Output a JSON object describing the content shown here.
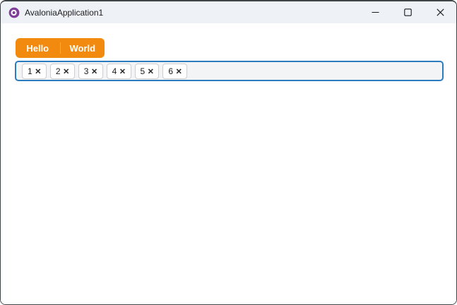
{
  "window": {
    "title": "AvaloniaApplication1",
    "app_icon": "avalonia-logo",
    "controls": [
      {
        "name": "minimize",
        "icon": "minimize-icon"
      },
      {
        "name": "maximize",
        "icon": "maximize-icon"
      },
      {
        "name": "close",
        "icon": "close-icon"
      }
    ]
  },
  "tab_control": {
    "tabs": [
      {
        "label": "Hello"
      },
      {
        "label": "World"
      }
    ]
  },
  "tag_box": {
    "chips": [
      {
        "label": "1"
      },
      {
        "label": "2"
      },
      {
        "label": "3"
      },
      {
        "label": "4"
      },
      {
        "label": "5"
      },
      {
        "label": "6"
      }
    ],
    "remove_glyph": "×"
  },
  "colors": {
    "titlebar_bg": "#EEF2F7",
    "window_border": "#3F4447",
    "accent_orange": "#F28A0F",
    "accent_orange_divider": "#F7AB52",
    "tag_border_blue": "#2B7CBF",
    "tag_box_bg": "#F3F4F6",
    "avalonia_purple": "#7F3F98"
  }
}
